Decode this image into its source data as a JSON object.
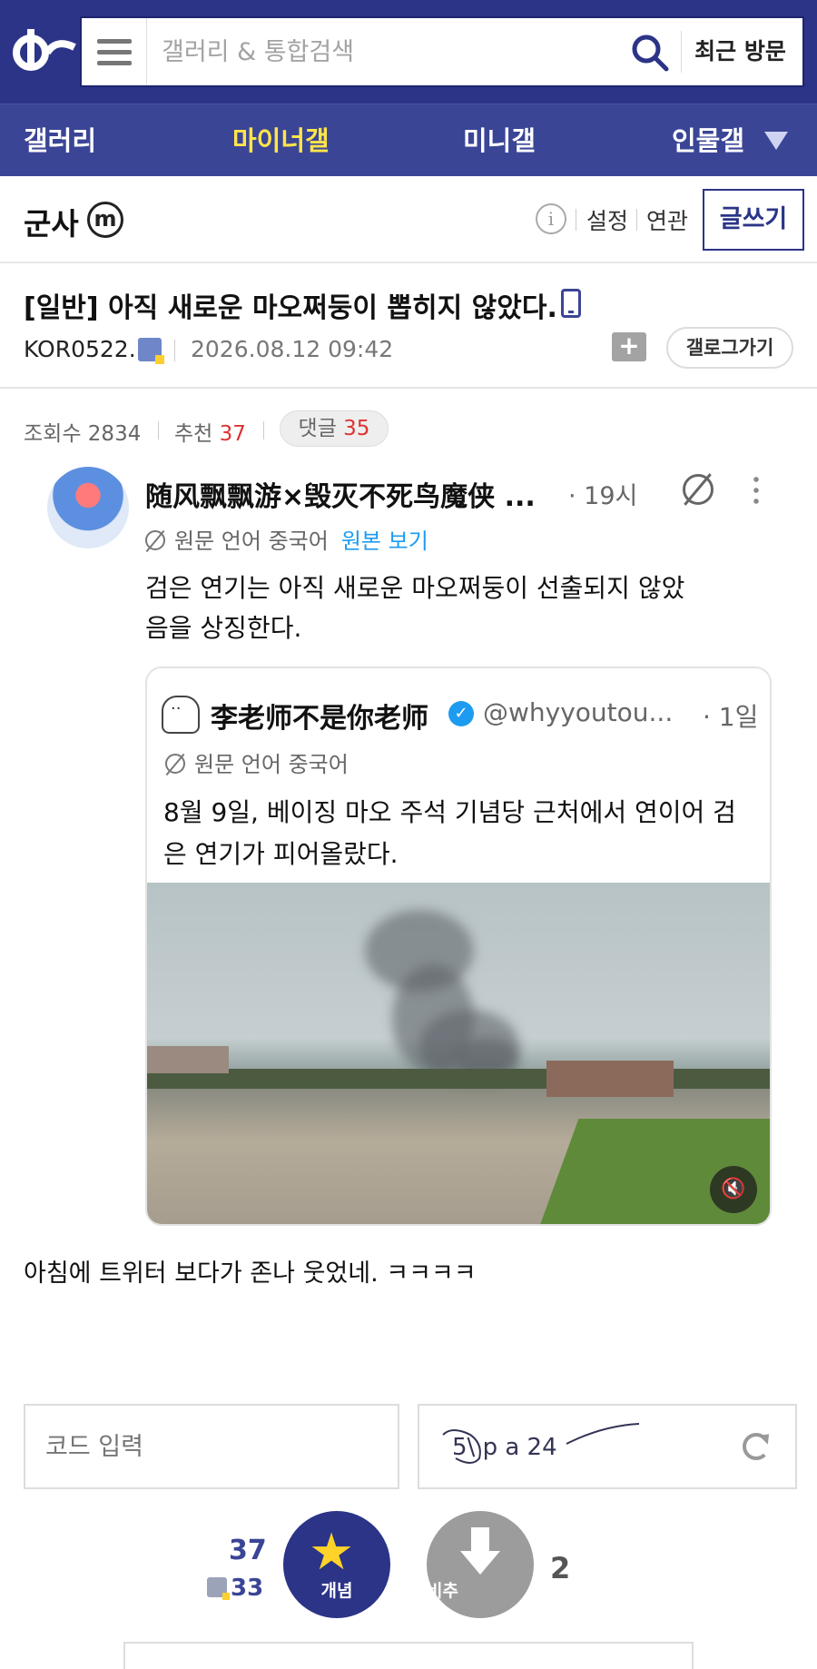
{
  "header": {
    "search_placeholder": "갤러리 & 통합검색",
    "recent_label": "최근 방문",
    "icons": {
      "logo": "dc-logo-icon",
      "menu": "hamburger-icon",
      "search": "search-icon"
    }
  },
  "nav": {
    "items": [
      {
        "label": "갤러리",
        "active": false
      },
      {
        "label": "마이너갤",
        "active": true
      },
      {
        "label": "미니갤",
        "active": false
      },
      {
        "label": "인물갤",
        "active": false
      }
    ],
    "active_color": "#ffe54a"
  },
  "gallery": {
    "name": "군사",
    "badge": "m",
    "settings_label": "설정",
    "related_label": "연관",
    "write_label": "글쓰기"
  },
  "post": {
    "title": "[일반] 아직 새로운 마오쩌둥이 뽑히지 않았다.",
    "author": "KOR0522..",
    "date": "2026.08.12 09:42",
    "gallog_label": "갤로그가기",
    "views_label": "조회수",
    "views": "2834",
    "recommend_label": "추천",
    "recommend": "37",
    "comments_label": "댓글",
    "comments": "35",
    "body": "아침에 트위터 보다가 존나 웃었네. ㅋㅋㅋㅋ"
  },
  "tweet": {
    "name": "随风飘飘游×毁灭不死鸟魔侠 ...",
    "time": "· 19시",
    "translate_note": "원문 언어 중국어",
    "original_link": "원본 보기",
    "text": "검은 연기는 아직 새로운 마오쩌둥이 선출되지 않았음을 상징한다.",
    "quote": {
      "name": "李老师不是你老师",
      "handle": "@whyyoutou...",
      "time": "· 1일",
      "translate_note": "원문 언어 중국어",
      "text": "8월 9일, 베이징 마오 주석 기념당 근처에서 연이어 검은 연기가 피어올랐다.",
      "video_icon": "mute-icon"
    }
  },
  "captcha": {
    "code_placeholder": "코드 입력",
    "image_text": "5\\ p a 24"
  },
  "votes": {
    "up_count": "37",
    "fixed_up_count": "33",
    "up_label": "개념",
    "down_label": "비추",
    "down_count": "2"
  },
  "colors": {
    "header_bg": "#2b3487",
    "nav_bg": "#3b4596",
    "recommend_red": "#dd3333"
  }
}
